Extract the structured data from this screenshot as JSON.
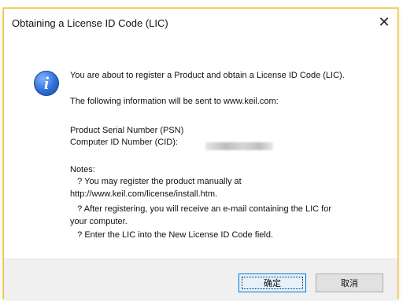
{
  "window": {
    "title": "Obtaining a License ID Code (LIC)",
    "close_glyph": "✕"
  },
  "icon": {
    "name": "info-icon",
    "glyph": "i"
  },
  "message": {
    "line1": "You are about to register a Product and obtain a License ID Code (LIC).",
    "line2": "The following information will be sent to www.keil.com:",
    "psn_label": "Product Serial Number (PSN)",
    "cid_label": "Computer ID Number (CID):",
    "notes_heading": "Notes:",
    "note1a": "   ? You may register the product manually at",
    "note1b": "http://www.keil.com/license/install.htm.",
    "note2a": "   ? After registering, you will receive an e-mail containing the LIC for",
    "note2b": "your computer.",
    "note3": "   ? Enter the LIC into the New License ID Code field."
  },
  "buttons": {
    "ok_label": "确定",
    "cancel_label": "取消"
  },
  "colors": {
    "dialog_border": "#f1c232",
    "ok_button_border": "#0078d7",
    "footer_bg": "#f0f0f0"
  }
}
